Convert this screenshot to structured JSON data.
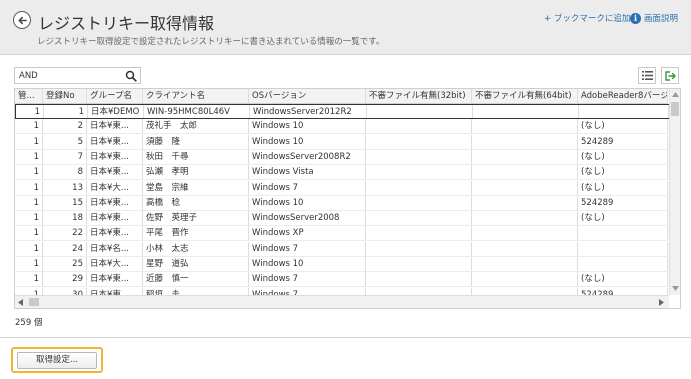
{
  "header": {
    "title": "レジストリキー取得情報",
    "description": "レジストリキー取得設定で設定されたレジストリキーに書き込まれている情報の一覧です。",
    "bookmark_label": "+ ブックマークに追加",
    "help_label": "画面説明",
    "help_icon": "i"
  },
  "search": {
    "value": "AND",
    "placeholder": ""
  },
  "icons": {
    "back": "arrow-left-circle",
    "search": "magnifier",
    "list": "list-view",
    "export": "export-arrow"
  },
  "table": {
    "columns": [
      "管...",
      "登録No",
      "グループ名",
      "クライアント名",
      "OSバージョン",
      "不審ファイル有無(32bit)",
      "不審ファイル有無(64bit)",
      "AdobeReader8バージ"
    ],
    "rows": [
      [
        "1",
        "1",
        "日本¥DEMO",
        "WIN-95HMC80L46V",
        "WindowsServer2012R2",
        "",
        "",
        ""
      ],
      [
        "1",
        "2",
        "日本¥東...",
        "茂礼手　太郎",
        "Windows 10",
        "",
        "",
        "(なし)"
      ],
      [
        "1",
        "5",
        "日本¥東...",
        "須藤　隆",
        "Windows 10",
        "",
        "",
        "524289"
      ],
      [
        "1",
        "7",
        "日本¥東...",
        "秋田　千尋",
        "WindowsServer2008R2",
        "",
        "",
        "(なし)"
      ],
      [
        "1",
        "8",
        "日本¥東...",
        "弘瀬　孝明",
        "Windows Vista",
        "",
        "",
        "(なし)"
      ],
      [
        "1",
        "13",
        "日本¥大...",
        "堂島　宗維",
        "Windows 7",
        "",
        "",
        "(なし)"
      ],
      [
        "1",
        "15",
        "日本¥東...",
        "高橋　稔",
        "Windows 10",
        "",
        "",
        "524289"
      ],
      [
        "1",
        "18",
        "日本¥東...",
        "佐野　英理子",
        "WindowsServer2008",
        "",
        "",
        "(なし)"
      ],
      [
        "1",
        "22",
        "日本¥東...",
        "平尾　晋作",
        "Windows XP",
        "",
        "",
        ""
      ],
      [
        "1",
        "24",
        "日本¥名...",
        "小林　太志",
        "Windows 7",
        "",
        "",
        ""
      ],
      [
        "1",
        "25",
        "日本¥大...",
        "星野　道弘",
        "Windows 10",
        "",
        "",
        ""
      ],
      [
        "1",
        "29",
        "日本¥東...",
        "近藤　慎一",
        "Windows 7",
        "",
        "",
        "(なし)"
      ],
      [
        "1",
        "30",
        "日本¥東...",
        "稲垣　圭",
        "Windows 7",
        "",
        "",
        "524289"
      ]
    ]
  },
  "footer": {
    "count": "259 個",
    "settings_button": "取得設定..."
  },
  "colors": {
    "accent_link": "#2a6fb0",
    "highlight_border": "#f5b335",
    "export_icon": "#2e9b3a"
  }
}
